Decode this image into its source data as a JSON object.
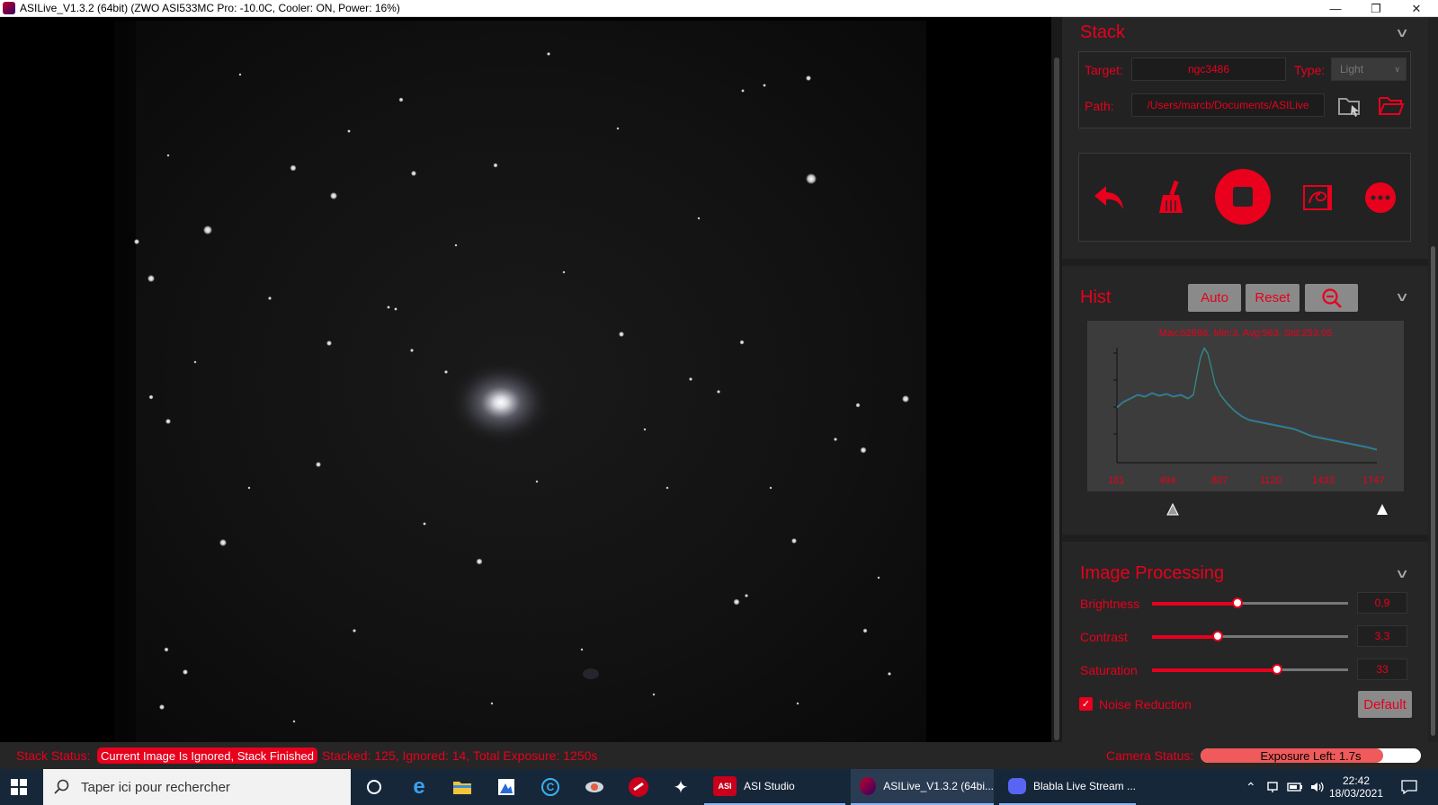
{
  "window": {
    "title": "ASILive_V1.3.2 (64bit)  (ZWO ASI533MC Pro: -10.0C, Cooler: ON, Power: 16%)",
    "minimize": "—",
    "restore": "❐",
    "close": "✕"
  },
  "stack": {
    "title": "Stack",
    "target_label": "Target:",
    "target_value": "ngc3486",
    "type_label": "Type:",
    "type_value": "Light",
    "path_label": "Path:",
    "path_value": "/Users/marcb/Documents/ASILive"
  },
  "hist": {
    "title": "Hist",
    "auto_label": "Auto",
    "reset_label": "Reset",
    "stats": "Max:62898, Min:3, Avg:563, Std:253.05",
    "x_ticks": [
      "181",
      "494",
      "807",
      "1120",
      "1433",
      "1747"
    ]
  },
  "image_processing": {
    "title": "Image Processing",
    "brightness_label": "Brightness",
    "brightness_value": "0,9",
    "brightness_level": 0.44,
    "contrast_label": "Contrast",
    "contrast_value": "3,3",
    "contrast_level": 0.34,
    "saturation_label": "Saturation",
    "saturation_value": "33",
    "saturation_level": 0.64,
    "noise_reduction_label": "Noise Reduction",
    "noise_reduction_checked": true,
    "default_label": "Default"
  },
  "status": {
    "stack_status_label": "Stack Status:",
    "stack_status_value": "Current Image Is Ignored, Stack Finished",
    "stack_info": "Stacked: 125, Ignored: 14, Total Exposure: 1250s",
    "camera_status_label": "Camera Status:",
    "exposure_text": "Exposure Left: 1.7s",
    "exposure_progress": 0.83
  },
  "taskbar": {
    "search_placeholder": "Taper ici pour rechercher",
    "asi_studio": "ASI Studio",
    "asi_studio_badge": "ASI",
    "asilive": "ASILive_V1.3.2 (64bi...",
    "discord": "Blabla Live Stream ...",
    "time": "22:42",
    "date": "18/03/2021"
  },
  "colors": {
    "accent": "#e8001c",
    "panel": "#262626",
    "taskbar": "#16273a"
  }
}
